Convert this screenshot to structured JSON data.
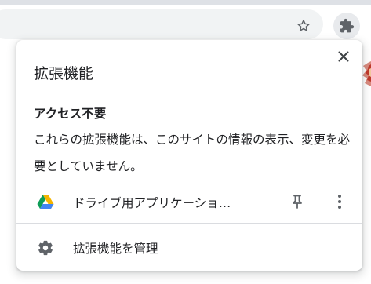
{
  "toolbar": {
    "bookmark_icon": "star-outline-icon",
    "extensions_icon": "puzzle-piece-icon"
  },
  "popup": {
    "title": "拡張機能",
    "close_icon": "close-icon",
    "section": {
      "heading": "アクセス不要",
      "description": "これらの拡張機能は、このサイトの情報の表示、変更を必要としていません。"
    },
    "extensions": [
      {
        "name": "ドライブ用アプリケーショ…",
        "icon": "google-drive-icon",
        "pin_icon": "pin-icon",
        "menu_icon": "more-vert-icon"
      }
    ],
    "manage": {
      "label": "拡張機能を管理",
      "icon": "gear-icon"
    }
  },
  "colors": {
    "text": "#202124",
    "icon_gray": "#5f6368",
    "divider": "#dadce0",
    "omnibox": "#f1f3f4",
    "ext_button_bg": "#e8eaed",
    "drive_blue": "#4285f4",
    "drive_green": "#0f9d58",
    "drive_yellow": "#f4b400"
  }
}
